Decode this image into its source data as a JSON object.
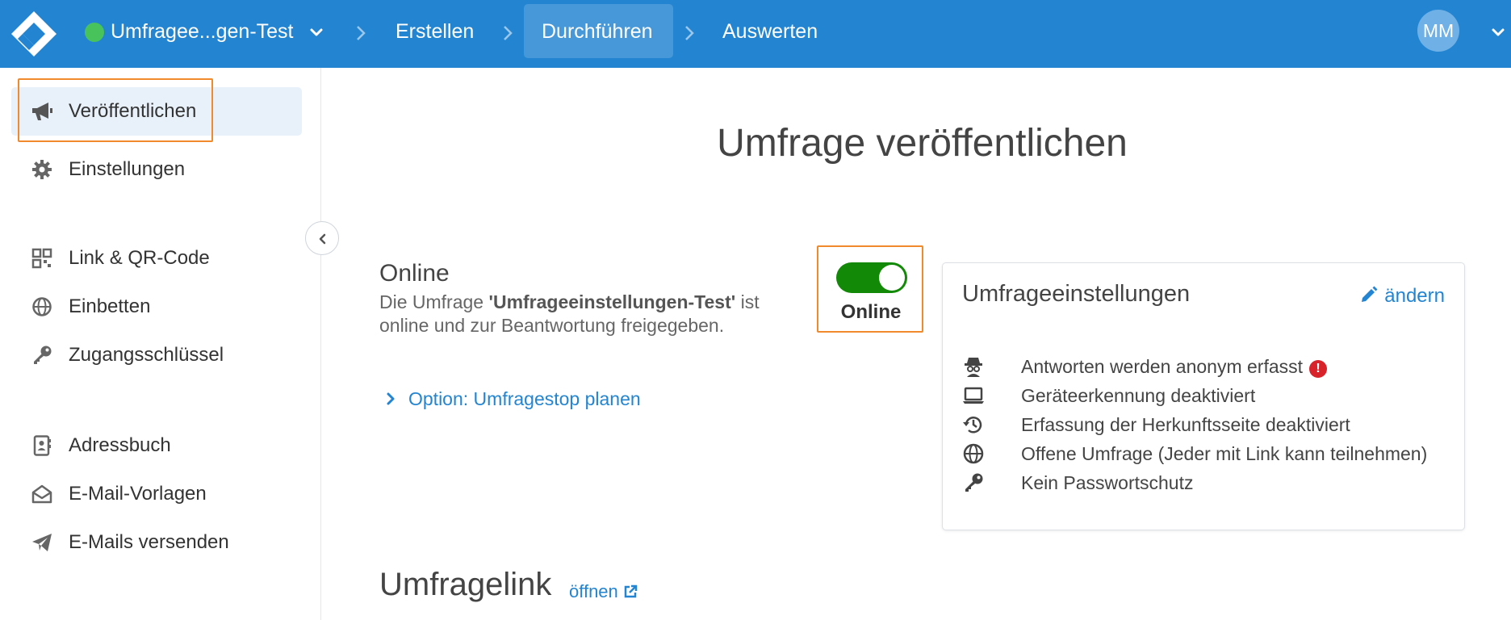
{
  "topbar": {
    "survey_name": "Umfragee...gen-Test",
    "nav": [
      {
        "label": "Erstellen"
      },
      {
        "label": "Durchführen"
      },
      {
        "label": "Auswerten"
      }
    ],
    "user_initials": "MM",
    "status_color": "#48c25b",
    "brand_color": "#2385d2"
  },
  "sidebar": {
    "items": [
      {
        "label": "Veröffentlichen",
        "icon": "megaphone-icon"
      },
      {
        "label": "Einstellungen",
        "icon": "gear-icon"
      },
      {
        "label": "Link & QR-Code",
        "icon": "qr-code-icon"
      },
      {
        "label": "Einbetten",
        "icon": "globe-icon"
      },
      {
        "label": "Zugangsschlüssel",
        "icon": "key-icon"
      },
      {
        "label": "Adressbuch",
        "icon": "address-book-icon"
      },
      {
        "label": "E-Mail-Vorlagen",
        "icon": "envelope-open-icon"
      },
      {
        "label": "E-Mails versenden",
        "icon": "paper-plane-icon"
      }
    ]
  },
  "main": {
    "title": "Umfrage veröffentlichen",
    "online": {
      "title": "Online",
      "desc_prefix": "Die Umfrage ",
      "survey_name_quoted": "'Umfrageeinstellungen-Test'",
      "desc_suffix": " ist online und zur Beantwortung freigegeben.",
      "toggle_label": "Online",
      "toggle_on": true
    },
    "option_link": "Option: Umfragestop planen",
    "settings_card": {
      "title": "Umfrageeinstellungen",
      "edit_label": "ändern",
      "items": [
        {
          "label": "Antworten werden anonym erfasst",
          "icon": "spy-icon",
          "warning": "!"
        },
        {
          "label": "Geräteerkennung deaktiviert",
          "icon": "laptop-icon"
        },
        {
          "label": "Erfassung der Herkunftsseite deaktiviert",
          "icon": "history-icon"
        },
        {
          "label": "Offene Umfrage (Jeder mit Link kann teilnehmen)",
          "icon": "globe-icon"
        },
        {
          "label": "Kein Passwortschutz",
          "icon": "key-icon"
        }
      ]
    },
    "link_section": {
      "title": "Umfragelink",
      "open_label": "öffnen"
    }
  }
}
